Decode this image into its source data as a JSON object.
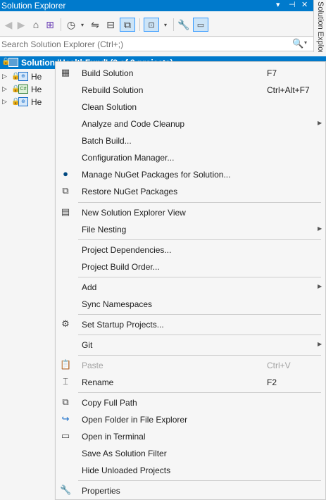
{
  "window": {
    "title": "Solution Explorer",
    "side_tab": "Solution Explorer",
    "controls": {
      "dropdown": "▾",
      "pin": "⊣",
      "close": "✕"
    }
  },
  "toolbar": {
    "icons": [
      "back-icon",
      "forward-icon",
      "home-icon",
      "switch-views-icon",
      "pending-changes-icon",
      "sync-icon",
      "collapse-all-icon",
      "show-all-files-icon",
      "preview-selected-icon",
      "properties-icon",
      "auto-hide-icon"
    ]
  },
  "search": {
    "placeholder": "Search Solution Explorer (Ctrl+;)",
    "icon": "🔍",
    "dropdown": "▾"
  },
  "tree": {
    "solution_label": "Solution 'HealthFund' (3 of 3 projects)",
    "projects": [
      {
        "label": "He",
        "icon": "web-project-icon"
      },
      {
        "label": "He",
        "icon": "csharp-project-icon"
      },
      {
        "label": "He",
        "icon": "web-project-icon"
      }
    ]
  },
  "menu": {
    "items": [
      {
        "id": "build-solution",
        "label": "Build Solution",
        "shortcut": "F7",
        "icon": "build-icon"
      },
      {
        "id": "rebuild-solution",
        "label": "Rebuild Solution",
        "shortcut": "Ctrl+Alt+F7"
      },
      {
        "id": "clean-solution",
        "label": "Clean Solution"
      },
      {
        "id": "analyze",
        "label": "Analyze and Code Cleanup",
        "submenu": true
      },
      {
        "id": "batch-build",
        "label": "Batch Build..."
      },
      {
        "id": "config-manager",
        "label": "Configuration Manager..."
      },
      {
        "id": "manage-nuget",
        "label": "Manage NuGet Packages for Solution...",
        "icon": "nuget-icon"
      },
      {
        "id": "restore-nuget",
        "label": "Restore NuGet Packages",
        "icon": "restore-packages-icon"
      },
      {
        "id": "new-view",
        "label": "New Solution Explorer View",
        "icon": "new-view-icon"
      },
      {
        "id": "file-nesting",
        "label": "File Nesting",
        "submenu": true
      },
      {
        "id": "project-deps",
        "label": "Project Dependencies..."
      },
      {
        "id": "build-order",
        "label": "Project Build Order..."
      },
      {
        "id": "add",
        "label": "Add",
        "submenu": true
      },
      {
        "id": "sync-ns",
        "label": "Sync Namespaces"
      },
      {
        "id": "startup",
        "label": "Set Startup Projects...",
        "icon": "gear-icon"
      },
      {
        "id": "git",
        "label": "Git",
        "submenu": true
      },
      {
        "id": "paste",
        "label": "Paste",
        "shortcut": "Ctrl+V",
        "icon": "paste-icon",
        "disabled": true
      },
      {
        "id": "rename",
        "label": "Rename",
        "shortcut": "F2",
        "icon": "rename-icon"
      },
      {
        "id": "copy-path",
        "label": "Copy Full Path",
        "icon": "copy-icon"
      },
      {
        "id": "open-folder",
        "label": "Open Folder in File Explorer",
        "icon": "open-folder-icon"
      },
      {
        "id": "terminal",
        "label": "Open in Terminal",
        "icon": "terminal-icon"
      },
      {
        "id": "save-filter",
        "label": "Save As Solution Filter"
      },
      {
        "id": "hide-unloaded",
        "label": "Hide Unloaded Projects"
      },
      {
        "id": "properties",
        "label": "Properties",
        "icon": "wrench-icon"
      }
    ]
  },
  "colors": {
    "accent": "#007acc",
    "menu_bg": "#f6f6f6",
    "disabled_text": "#a2a2a2"
  }
}
